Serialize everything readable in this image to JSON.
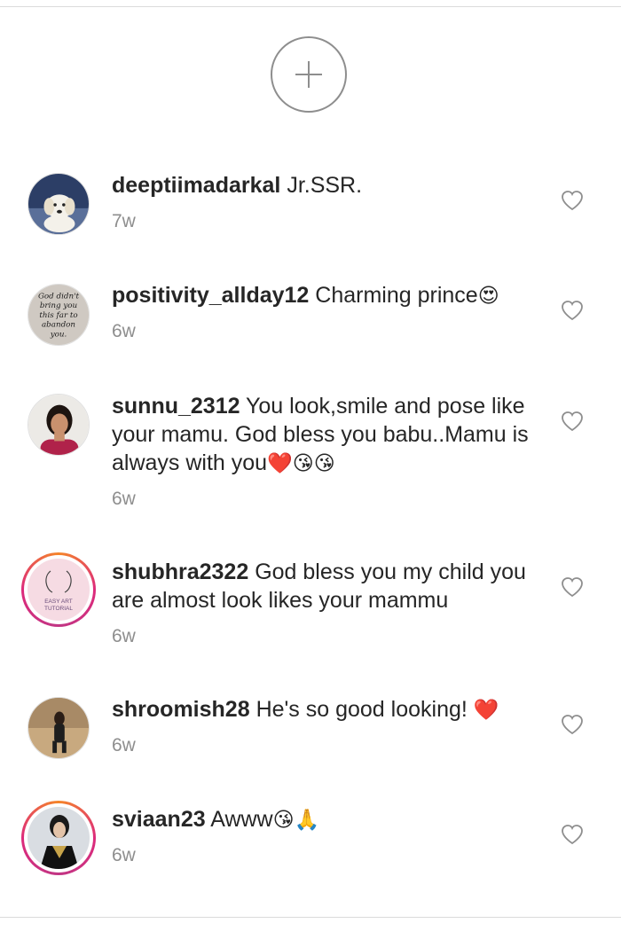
{
  "load_more": {
    "icon": "plus-icon"
  },
  "comments": [
    {
      "username": "deeptiimadarkal",
      "text": "Jr.SSR.",
      "emoji": "",
      "time": "7w"
    },
    {
      "username": "positivity_allday12",
      "text": "Charming prince",
      "emoji": "😍",
      "time": "6w"
    },
    {
      "username": "sunnu_2312",
      "text": "You look,smile and pose like your mamu. God bless you babu..Mamu is always with you",
      "emoji": "❤️😘😘",
      "time": "6w"
    },
    {
      "username": "shubhra2322",
      "text": "God bless you my child you are almost look likes your mammu",
      "emoji": "",
      "time": "6w"
    },
    {
      "username": "shroomish28",
      "text": "He's so good looking! ",
      "emoji": "❤️",
      "time": "6w"
    },
    {
      "username": "sviaan23",
      "text": "Awww",
      "emoji": "😘🙏",
      "time": "6w"
    }
  ],
  "avatar_2_text": [
    "God didn't",
    "bring you",
    "this far to",
    "abandon",
    "you."
  ],
  "avatar_4_text": [
    "EASY ART",
    "TUTORIAL"
  ],
  "colors": {
    "ring_start": "#f58529",
    "ring_mid": "#dd2a7b",
    "heart_stroke": "#8e8e8e",
    "time": "#8e8e8e"
  }
}
